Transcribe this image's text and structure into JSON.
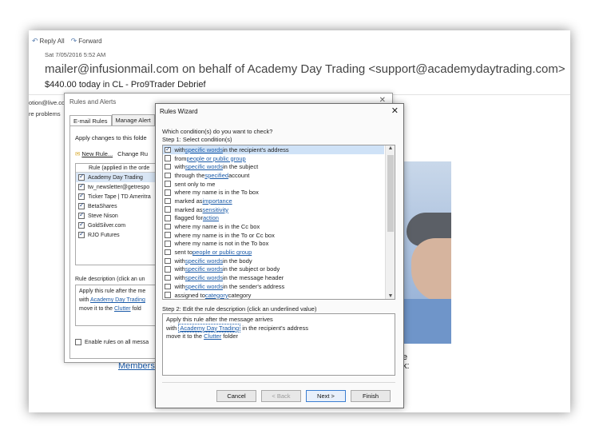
{
  "email": {
    "reply_all": "Reply All",
    "forward": "Forward",
    "date": "Sat 7/05/2016 5:52 AM",
    "from": "mailer@infusionmail.com on behalf of Academy Day Trading <support@academydaytrading.com>",
    "subject": "$440.00 today in CL - Pro9Trader Debrief",
    "clip1": "otion@live.co",
    "clip2": "re problems",
    "members": "Members",
    "frag1": "e",
    "frag2": "k:"
  },
  "rules_alerts": {
    "title": "Rules and Alerts",
    "tab_email": "E-mail Rules",
    "tab_manage": "Manage Alert",
    "apply_to": "Apply changes to this folde",
    "new_rule": "New Rule...",
    "change_rule": "Change Ru",
    "list_header": "Rule (applied in the orde",
    "rules": [
      {
        "label": "Academy Day Trading",
        "checked": true,
        "selected": true
      },
      {
        "label": "tw_newsletter@getrespo",
        "checked": true
      },
      {
        "label": "Ticker Tape | TD Ameritra",
        "checked": true
      },
      {
        "label": "BetaShares",
        "checked": true
      },
      {
        "label": "Steve Nison",
        "checked": true
      },
      {
        "label": "GoldSilver.com",
        "checked": true
      },
      {
        "label": "RJO Futures",
        "checked": true
      }
    ],
    "desc_label": "Rule description (click an un",
    "desc_line1": "Apply this rule after the me",
    "desc_line2_prefix": "with ",
    "desc_line2_link": "Academy Day Trading",
    "desc_line3_prefix": "move it to the ",
    "desc_line3_link": "Clutter",
    "desc_line3_suffix": " fold",
    "enable_label": "Enable rules on all messa"
  },
  "wizard": {
    "title": "Rules Wizard",
    "question": "Which condition(s) do you want to check?",
    "step1": "Step 1: Select condition(s)",
    "conditions": [
      {
        "pre": "with ",
        "link": "specific words",
        "post": " in the recipient's address",
        "checked": true,
        "selected": true
      },
      {
        "pre": "from ",
        "link": "people or public group",
        "post": ""
      },
      {
        "pre": "with ",
        "link": "specific words",
        "post": " in the subject"
      },
      {
        "pre": "through the ",
        "link": "specified",
        "post": " account"
      },
      {
        "pre": "sent only to me",
        "link": "",
        "post": ""
      },
      {
        "pre": "where my name is in the To box",
        "link": "",
        "post": ""
      },
      {
        "pre": "marked as ",
        "link": "importance",
        "post": ""
      },
      {
        "pre": "marked as ",
        "link": "sensitivity",
        "post": ""
      },
      {
        "pre": "flagged for ",
        "link": "action",
        "post": ""
      },
      {
        "pre": "where my name is in the Cc box",
        "link": "",
        "post": ""
      },
      {
        "pre": "where my name is in the To or Cc box",
        "link": "",
        "post": ""
      },
      {
        "pre": "where my name is not in the To box",
        "link": "",
        "post": ""
      },
      {
        "pre": "sent to ",
        "link": "people or public group",
        "post": ""
      },
      {
        "pre": "with ",
        "link": "specific words",
        "post": " in the body"
      },
      {
        "pre": "with ",
        "link": "specific words",
        "post": " in the subject or body"
      },
      {
        "pre": "with ",
        "link": "specific words",
        "post": " in the message header"
      },
      {
        "pre": "with ",
        "link": "specific words",
        "post": " in the sender's address"
      },
      {
        "pre": "assigned to ",
        "link": "category",
        "post": " category"
      }
    ],
    "step2": "Step 2: Edit the rule description (click an underlined value)",
    "desc_line1": "Apply this rule after the message arrives",
    "desc_line2_prefix": "with ",
    "desc_line2_link": "Academy Day Trading",
    "desc_line2_suffix": " in the recipient's address",
    "desc_line3_prefix": "move it to the ",
    "desc_line3_link": "Clutter",
    "desc_line3_suffix": " folder",
    "buttons": {
      "cancel": "Cancel",
      "back": "< Back",
      "next": "Next >",
      "finish": "Finish"
    }
  }
}
